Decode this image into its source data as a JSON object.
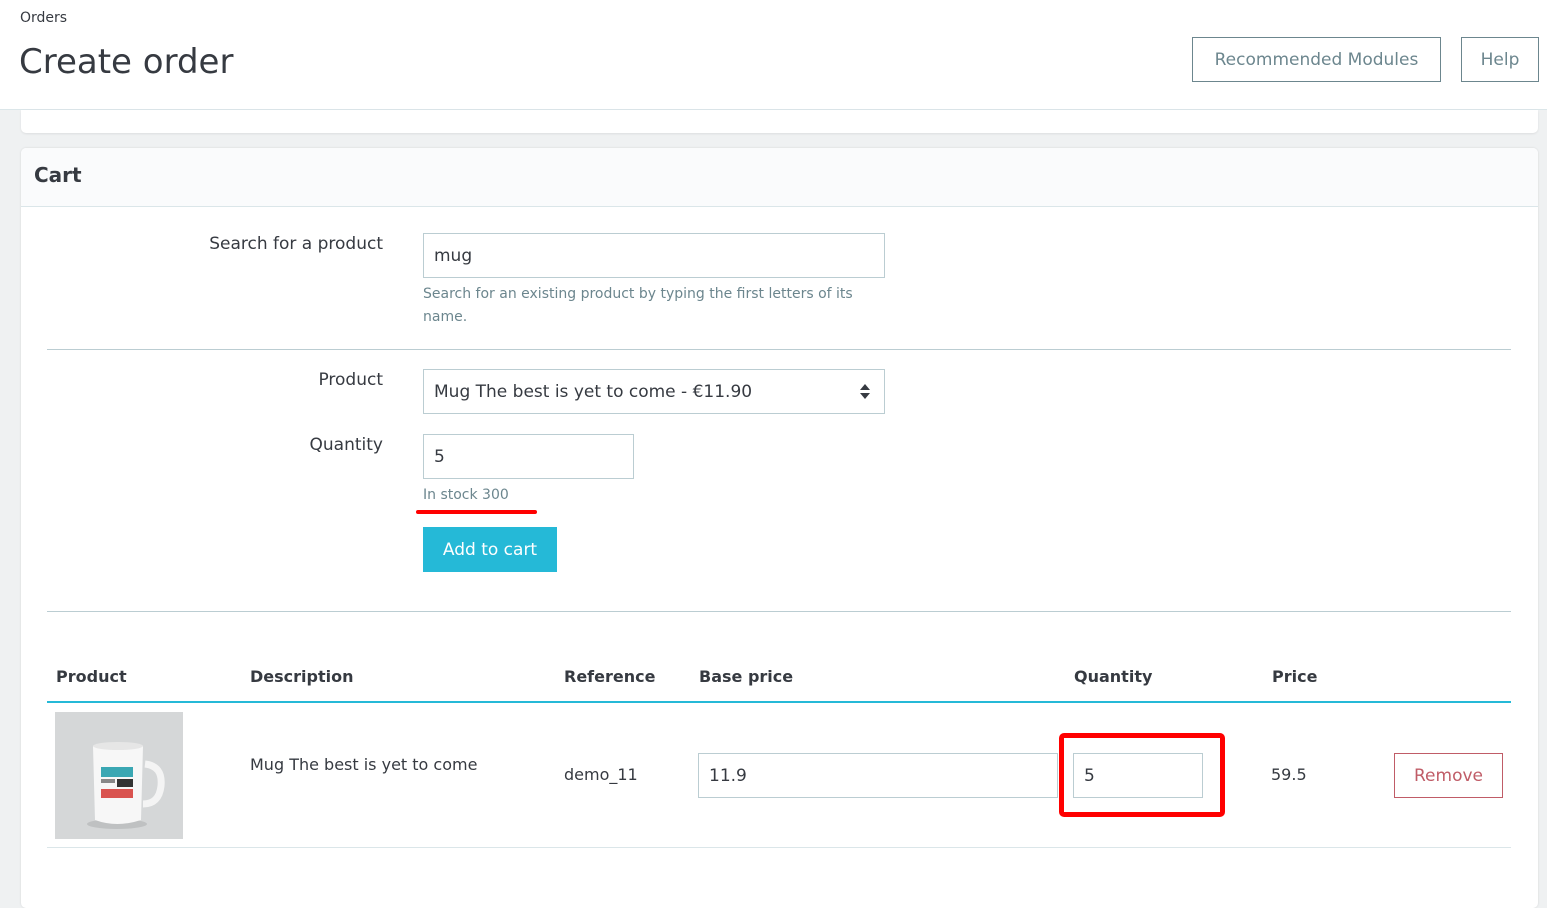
{
  "header": {
    "breadcrumb": "Orders",
    "title": "Create order",
    "recommended_modules_label": "Recommended Modules",
    "help_label": "Help"
  },
  "cart": {
    "title": "Cart",
    "search": {
      "label": "Search for a product",
      "value": "mug",
      "help": "Search for an existing product by typing the first letters of its name."
    },
    "product": {
      "label": "Product",
      "selected": "Mug The best is yet to come - €11.90"
    },
    "quantity": {
      "label": "Quantity",
      "value": "5",
      "stock": "In stock 300"
    },
    "add_to_cart_label": "Add to cart",
    "table": {
      "columns": [
        "Product",
        "Description",
        "Reference",
        "Base price",
        "Quantity",
        "Price"
      ],
      "rows": [
        {
          "image_alt": "mug-image",
          "description": "Mug The best is yet to come",
          "reference": "demo_11",
          "base_price": "11.9",
          "quantity": "5",
          "price": "59.5",
          "remove_label": "Remove"
        }
      ]
    }
  },
  "colors": {
    "accent": "#25b9d7",
    "danger": "#c05c67",
    "annotation": "#ff0000"
  }
}
